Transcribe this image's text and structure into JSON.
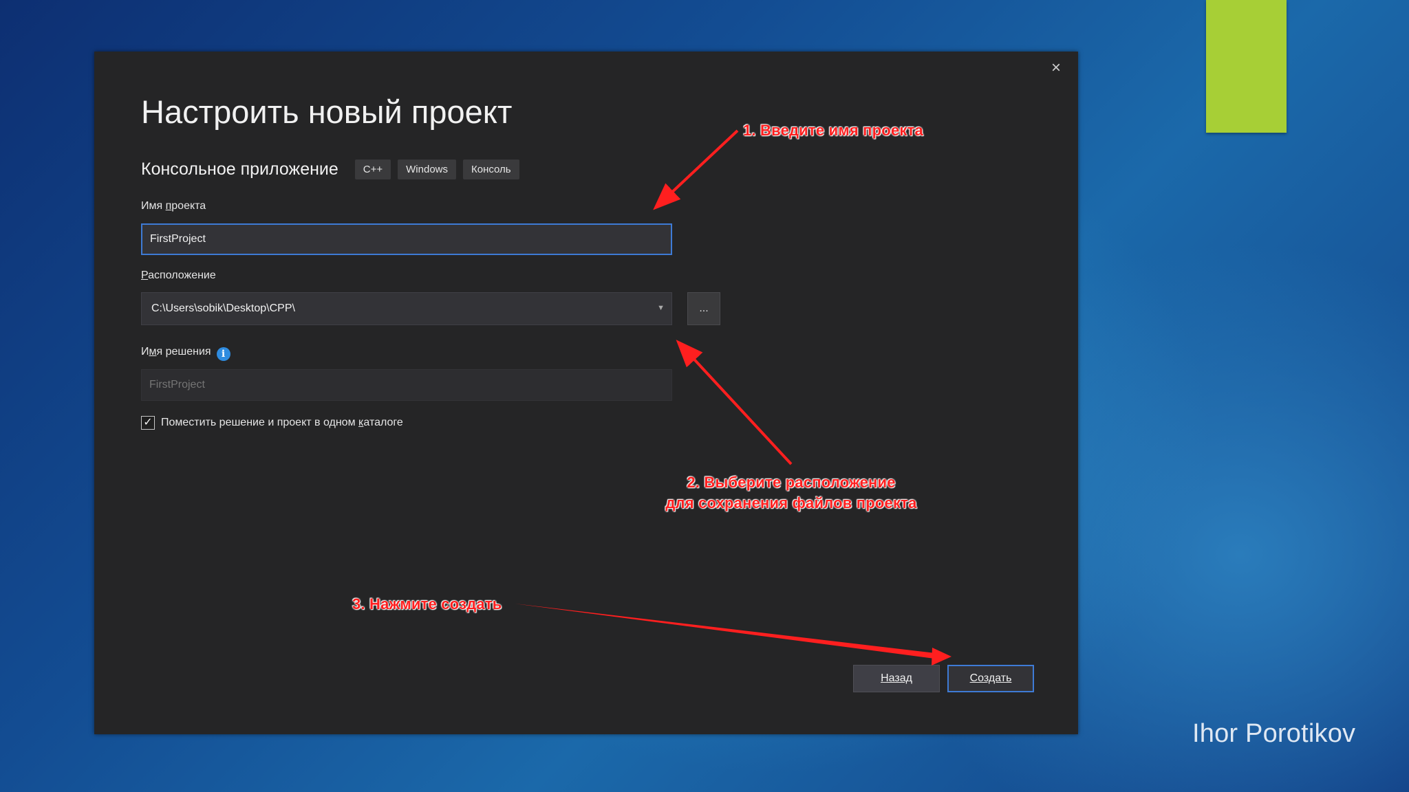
{
  "dialog": {
    "close_icon": "×",
    "title": "Настроить новый проект",
    "subtitle": "Консольное приложение",
    "tags": [
      "C++",
      "Windows",
      "Консоль"
    ],
    "project_name": {
      "label_prefix": "Имя ",
      "label_underlined": "п",
      "label_suffix": "роекта",
      "value": "FirstProject"
    },
    "location": {
      "label_underlined": "Р",
      "label_suffix": "асположение",
      "value": "C:\\Users\\sobik\\Desktop\\CPP\\",
      "browse_label": "..."
    },
    "solution_name": {
      "label_prefix": "И",
      "label_underlined": "м",
      "label_suffix": "я решения",
      "info_icon": "i",
      "placeholder": "FirstProject"
    },
    "same_dir": {
      "checked": true,
      "check_glyph": "✓",
      "label_prefix": "Поместить решение и проект в одном ",
      "label_underlined": "к",
      "label_suffix": "аталоге"
    },
    "buttons": {
      "back": "Назад",
      "create": "Создать"
    }
  },
  "annotations": {
    "step1": "1. Введите имя проекта",
    "step2_line1": "2. Выберите расположение",
    "step2_line2": "для сохранения файлов проекта",
    "step3": "3. Нажмите создать",
    "color": "#ff1f1f"
  },
  "slide": {
    "author": "Ihor Porotikov",
    "accent_color": "#a7cf36"
  }
}
